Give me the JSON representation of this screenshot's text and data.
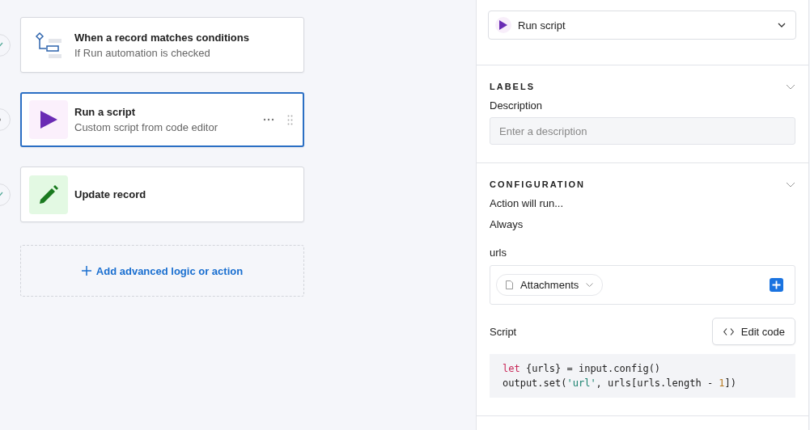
{
  "steps": [
    {
      "kind": "condition",
      "title": "When a record matches conditions",
      "subtitle": "If Run automation is checked",
      "selected": false,
      "checked": true
    },
    {
      "kind": "script",
      "title": "Run a script",
      "subtitle": "Custom script from code editor",
      "selected": true,
      "checked": false
    },
    {
      "kind": "update",
      "title": "Update record",
      "selected": false,
      "checked": true
    }
  ],
  "add_action": {
    "label": "Add advanced logic or action"
  },
  "action_type": {
    "value": "Run script"
  },
  "labels_section": {
    "title": "LABELS",
    "field_label": "Description",
    "placeholder": "Enter a description"
  },
  "configuration": {
    "title": "CONFIGURATION",
    "run_label": "Action will run...",
    "run_value": "Always",
    "input_name": "urls",
    "input_token": "Attachments",
    "script_label": "Script",
    "edit_button": "Edit code",
    "code": [
      [
        {
          "kind": "keyword",
          "text": "let"
        },
        {
          "kind": "plain",
          "text": " {urls} = input.config()"
        }
      ],
      [
        {
          "kind": "plain",
          "text": "output.set("
        },
        {
          "kind": "string",
          "text": "'url'"
        },
        {
          "kind": "plain",
          "text": ", urls[urls.length - "
        },
        {
          "kind": "number",
          "text": "1"
        },
        {
          "kind": "plain",
          "text": "])"
        }
      ]
    ]
  }
}
